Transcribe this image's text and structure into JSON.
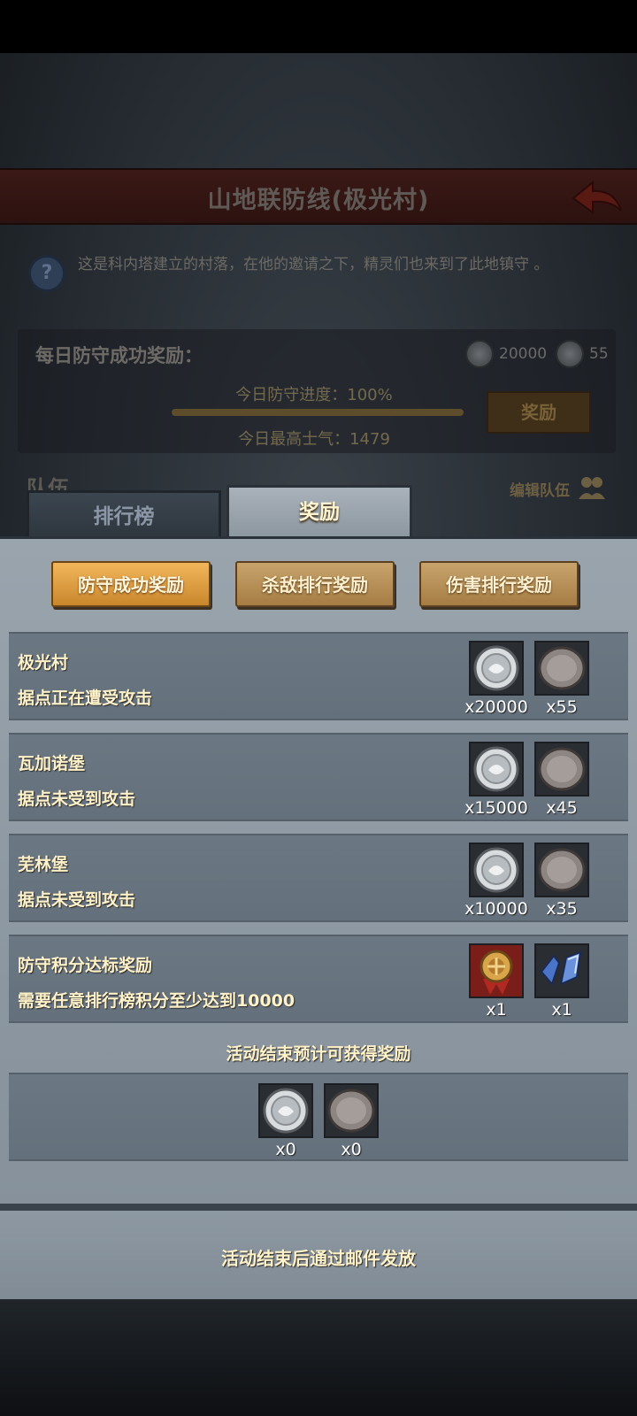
{
  "background": {
    "title": "山地联防线(极光村)",
    "intro": "这是科内塔建立的村落，在他的邀请之下，精灵们也来到了此地镇守 。",
    "daily_reward_label": "每日防守成功奖励：",
    "daily_silver": "20000",
    "daily_stone": "55",
    "progress_text": "今日防守进度：100%",
    "morale_text": "今日最高士气：1479",
    "reward_button": "奖励",
    "team_label": "队伍",
    "edit_team": "编辑队伍"
  },
  "tabs": [
    {
      "label": "排行榜",
      "active": false
    },
    {
      "label": "奖励",
      "active": true
    }
  ],
  "subtabs": [
    {
      "label": "防守成功奖励",
      "active": true
    },
    {
      "label": "杀敌排行奖励",
      "active": false
    },
    {
      "label": "伤害排行奖励",
      "active": false
    }
  ],
  "rows": [
    {
      "title": "极光村",
      "status": "据点正在遭受攻击",
      "items": [
        {
          "icon": "silver-coin-icon",
          "count": "x20000"
        },
        {
          "icon": "stone-coin-icon",
          "count": "x55"
        }
      ]
    },
    {
      "title": "瓦加诺堡",
      "status": "据点未受到攻击",
      "items": [
        {
          "icon": "silver-coin-icon",
          "count": "x15000"
        },
        {
          "icon": "stone-coin-icon",
          "count": "x45"
        }
      ]
    },
    {
      "title": "芜林堡",
      "status": "据点未受到攻击",
      "items": [
        {
          "icon": "silver-coin-icon",
          "count": "x10000"
        },
        {
          "icon": "stone-coin-icon",
          "count": "x35"
        }
      ]
    },
    {
      "title": "防守积分达标奖励",
      "status": "需要任意排行榜积分至少达到10000",
      "items": [
        {
          "icon": "medal-icon",
          "count": "x1"
        },
        {
          "icon": "blue-armor-icon",
          "count": "x1"
        }
      ]
    }
  ],
  "estimate": {
    "title": "活动结束预计可获得奖励",
    "items": [
      {
        "icon": "silver-coin-icon",
        "count": "x0"
      },
      {
        "icon": "stone-coin-icon",
        "count": "x0"
      }
    ]
  },
  "footer": "活动结束后通过邮件发放",
  "colors": {
    "accent_gold": "#f2b65a",
    "panel": "#6b7782",
    "text_cream": "#fff2c8"
  }
}
